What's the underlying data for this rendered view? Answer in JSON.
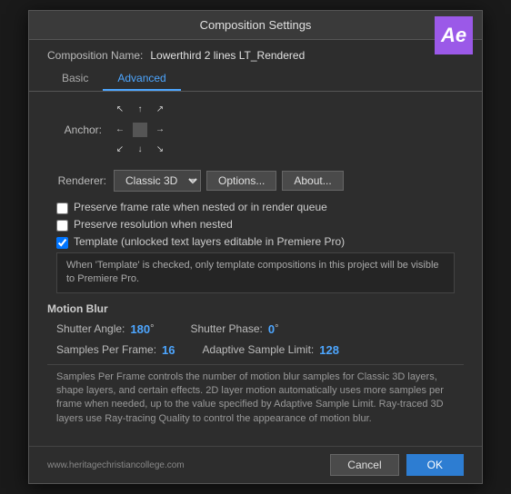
{
  "dialog": {
    "title": "Composition Settings",
    "ae_logo": "Ae"
  },
  "comp_name": {
    "label": "Composition Name:",
    "value": "Lowerthird 2 lines LT_Rendered"
  },
  "tabs": [
    {
      "id": "basic",
      "label": "Basic",
      "active": false
    },
    {
      "id": "advanced",
      "label": "Advanced",
      "active": true
    }
  ],
  "anchor": {
    "label": "Anchor:"
  },
  "renderer": {
    "label": "Renderer:",
    "value": "Classic 3D",
    "options_label": "Options...",
    "about_label": "About..."
  },
  "checkboxes": [
    {
      "id": "preserve_frame",
      "label": "Preserve frame rate when nested or in render queue",
      "checked": false
    },
    {
      "id": "preserve_res",
      "label": "Preserve resolution when nested",
      "checked": false
    },
    {
      "id": "template",
      "label": "Template (unlocked text layers editable in Premiere Pro)",
      "checked": true
    }
  ],
  "template_note": "When 'Template' is checked, only template compositions in this project will be visible to Premiere Pro.",
  "motion_blur": {
    "title": "Motion Blur",
    "shutter_angle_label": "Shutter Angle:",
    "shutter_angle_value": "180",
    "shutter_angle_unit": "°",
    "shutter_phase_label": "Shutter Phase:",
    "shutter_phase_value": "0",
    "shutter_phase_unit": "°",
    "samples_label": "Samples Per Frame:",
    "samples_value": "16",
    "adaptive_label": "Adaptive Sample Limit:",
    "adaptive_value": "128"
  },
  "samples_note": "Samples Per Frame controls the number of motion blur samples for Classic 3D layers, shape layers, and certain effects. 2D layer motion automatically uses more samples per frame when needed, up to the value specified by Adaptive Sample Limit. Ray-traced 3D layers use Ray-tracing Quality to control the appearance of motion blur.",
  "footer": {
    "url": "www.heritagechristiancollege.com",
    "cancel_label": "Cancel",
    "ok_label": "OK"
  }
}
